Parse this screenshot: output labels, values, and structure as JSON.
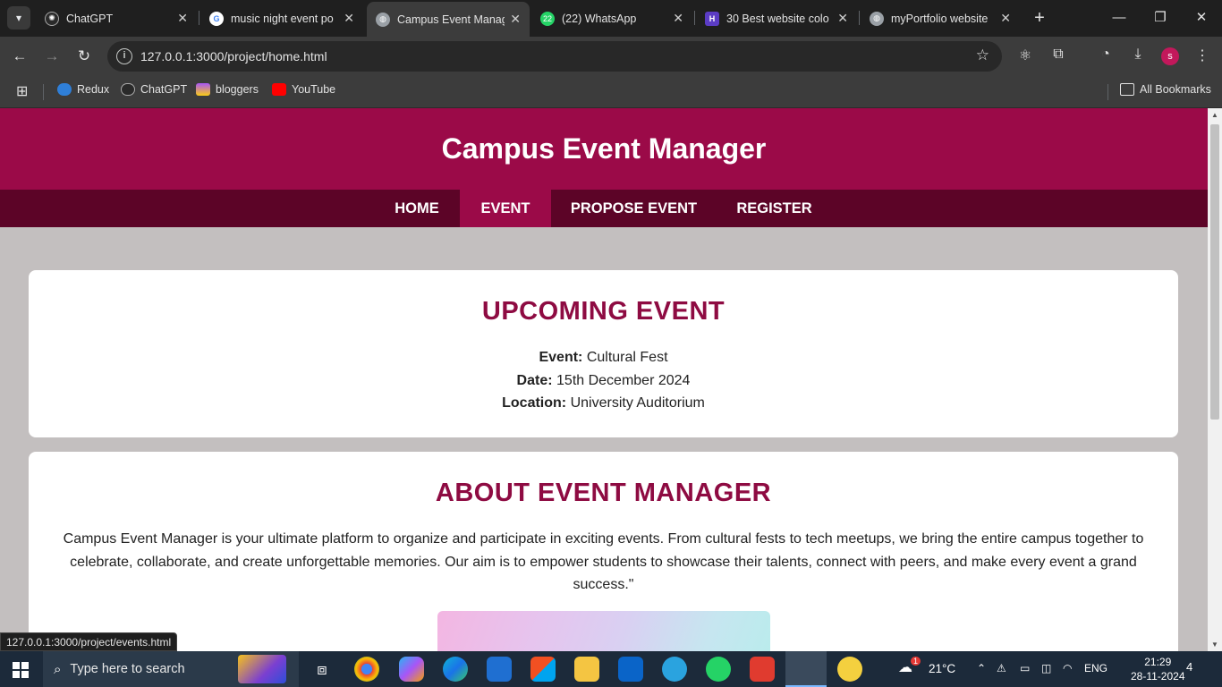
{
  "browser": {
    "tabs": [
      {
        "title": "ChatGPT",
        "active": false
      },
      {
        "title": "music night event po",
        "active": false
      },
      {
        "title": "Campus Event Manag",
        "active": true
      },
      {
        "title": "(22) WhatsApp",
        "active": false
      },
      {
        "title": "30 Best website colo",
        "active": false
      },
      {
        "title": "myPortfolio website",
        "active": false
      }
    ],
    "whatsapp_badge": "22",
    "url": "127.0.0.1:3000/project/home.html",
    "profile_initial": "s",
    "bookmarks": [
      "Redux",
      "ChatGPT",
      "bloggers",
      "YouTube"
    ],
    "all_bookmarks": "All Bookmarks",
    "status_url": "127.0.0.1:3000/project/events.html"
  },
  "site": {
    "title": "Campus Event Manager",
    "nav": [
      "HOME",
      "EVENT",
      "PROPOSE EVENT",
      "REGISTER"
    ],
    "active_nav": "EVENT",
    "upcoming": {
      "heading": "UPCOMING EVENT",
      "event_label": "Event:",
      "event_value": "Cultural Fest",
      "date_label": "Date:",
      "date_value": "15th December 2024",
      "location_label": "Location:",
      "location_value": "University Auditorium"
    },
    "about": {
      "heading": "ABOUT EVENT MANAGER",
      "text": "Campus Event Manager is your ultimate platform to organize and participate in exciting events. From cultural fests to tech meetups, we bring the entire campus together to celebrate, collaborate, and create unforgettable memories. Our aim is to empower students to showcase their talents, connect with peers, and make every event a grand success.\""
    }
  },
  "taskbar": {
    "search_placeholder": "Type here to search",
    "temperature": "21°C",
    "language": "ENG",
    "time": "21:29",
    "date": "28-11-2024",
    "weather_badge": "1",
    "notification_count": "4"
  },
  "colors": {
    "header": "#9b0a48",
    "nav": "#5c0427",
    "heading": "#8e0b42",
    "page_bg": "#c3bfbf"
  }
}
